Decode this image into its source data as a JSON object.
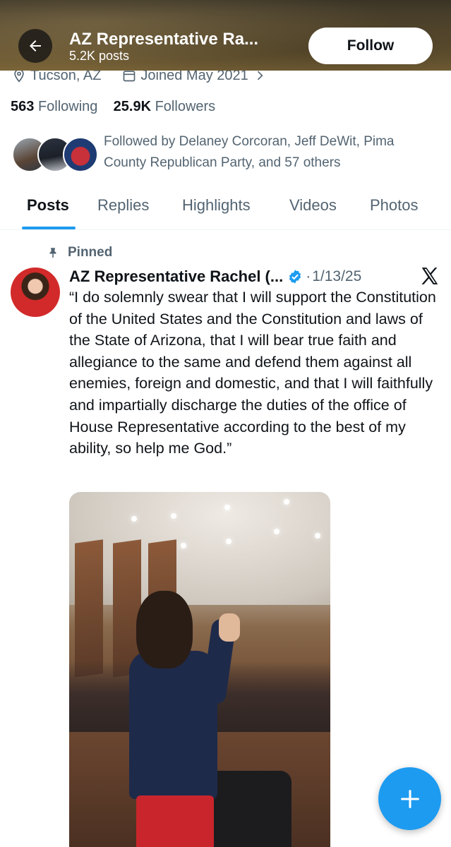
{
  "header": {
    "title": "AZ Representative Ra...",
    "posts_count": "5.2K posts",
    "follow_label": "Follow"
  },
  "profile": {
    "location": "Tucson, AZ",
    "joined": "Joined May 2021",
    "following_count": "563",
    "following_label": "Following",
    "followers_count": "25.9K",
    "followers_label": "Followers",
    "followed_by": "Followed by Delaney Corcoran, Jeff DeWit, Pima County Republican Party, and 57 others"
  },
  "tabs": [
    {
      "label": "Posts",
      "active": true
    },
    {
      "label": "Replies",
      "active": false
    },
    {
      "label": "Highlights",
      "active": false
    },
    {
      "label": "Videos",
      "active": false
    },
    {
      "label": "Photos",
      "active": false
    }
  ],
  "post": {
    "pinned_label": "Pinned",
    "author": "AZ Representative Rachel (...",
    "separator": "·",
    "date": "1/13/25",
    "text": "“I do solemnly swear that I will support the Constitution of the United States and the Constitution and laws of the State of Arizona, that I will bear true faith and allegiance to the same and defend them against all enemies, foreign and domestic, and that I will faithfully and impartially discharge the duties of the office of House Representative according to the best of my ability, so help me God.”"
  },
  "colors": {
    "accent": "#1d9bf0",
    "text_primary": "#0f1419",
    "text_secondary": "#536471"
  },
  "icons": {
    "back": "back-arrow-icon",
    "location": "location-pin-icon",
    "calendar": "calendar-icon",
    "chevron": "chevron-right-icon",
    "pin": "pin-icon",
    "verified": "verified-badge-icon",
    "brand": "x-logo-icon",
    "compose": "plus-icon"
  }
}
